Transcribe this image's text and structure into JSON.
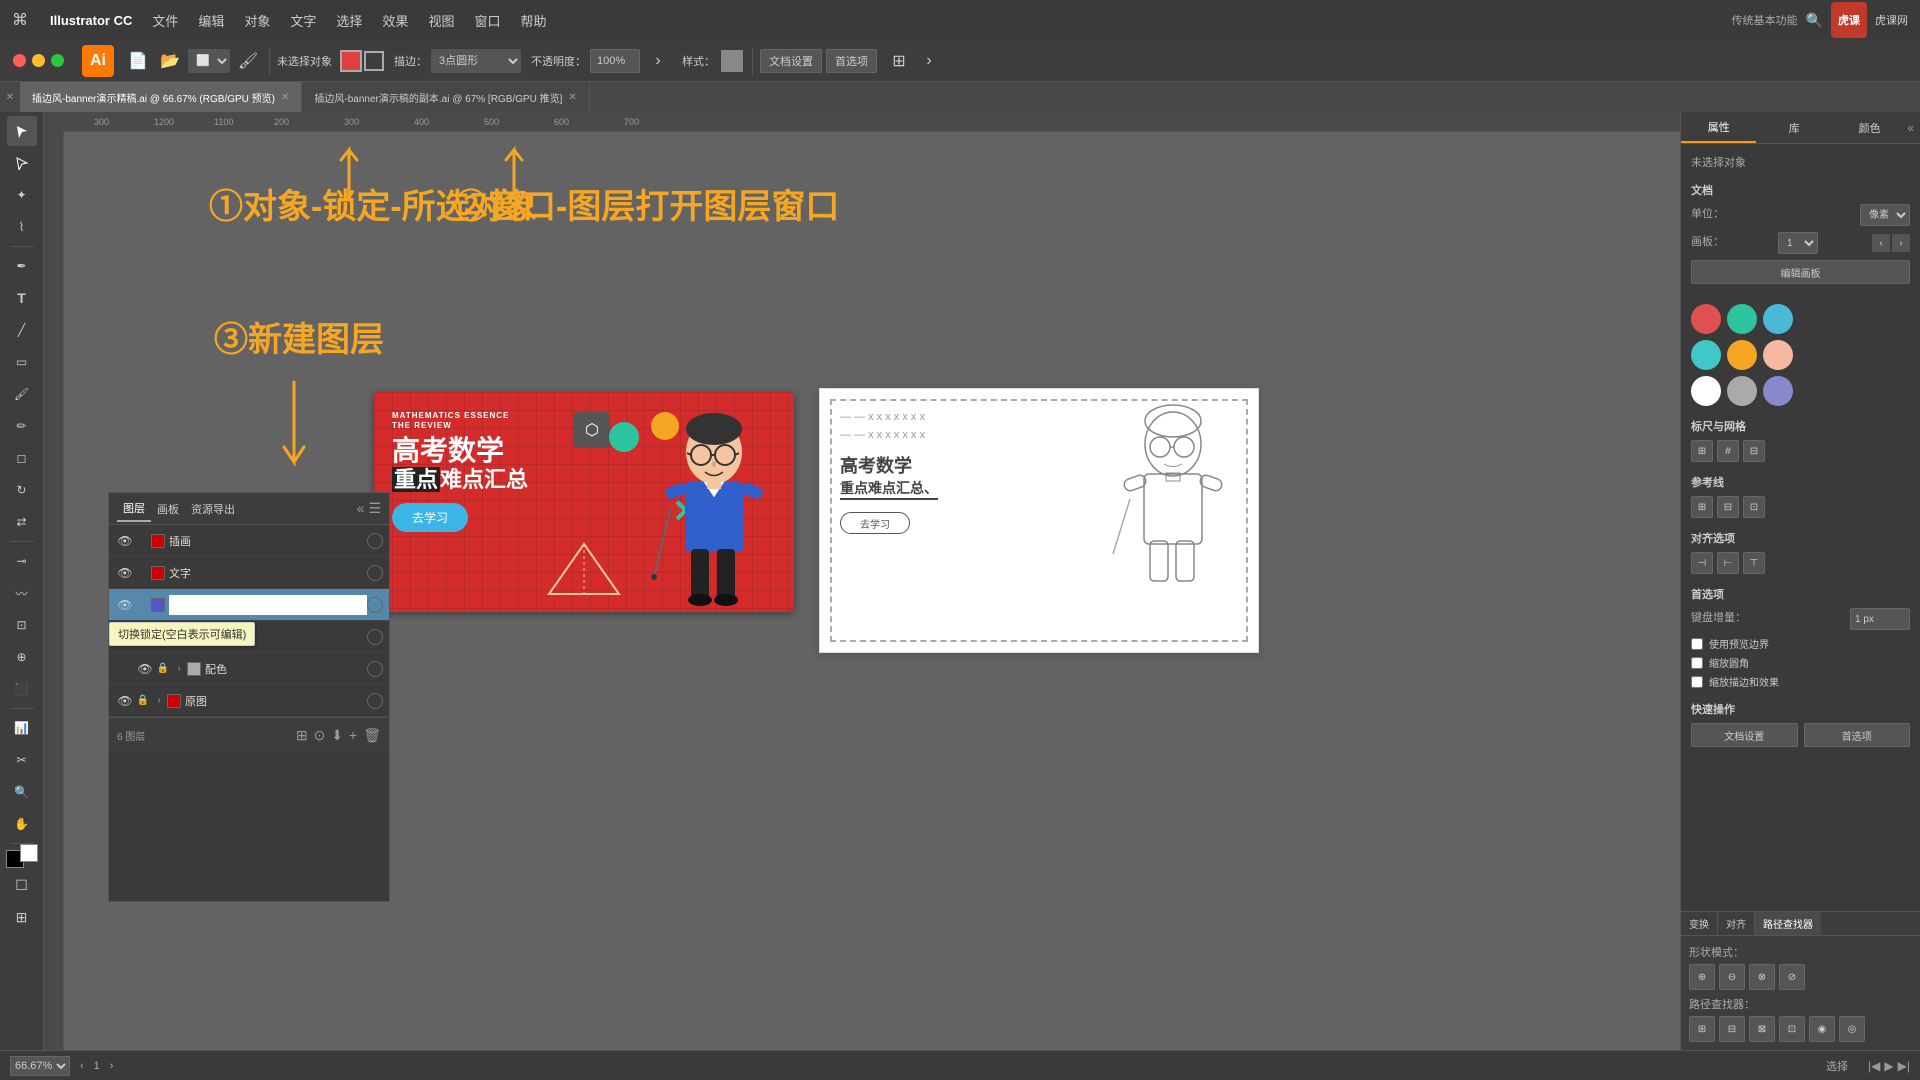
{
  "app": {
    "name": "Illustrator CC",
    "logo": "Ai",
    "title_bar_bg": "#3a3a3a"
  },
  "menu": {
    "apple": "⌘",
    "items": [
      "Illustrator CC",
      "文件",
      "编辑",
      "对象",
      "文字",
      "选择",
      "效果",
      "视图",
      "窗口",
      "帮助"
    ]
  },
  "toolbar": {
    "no_selection": "未选择对象",
    "desc_label": "描边：",
    "shape_dropdown": "3点圆形",
    "opacity_label": "不透明度：",
    "opacity_value": "100%",
    "style_label": "样式：",
    "doc_settings": "文档设置",
    "preferences": "首选项"
  },
  "tabs": [
    {
      "label": "插边风-banner演示精稿.ai @ 66.67% (RGB/GPU 预览)",
      "active": true
    },
    {
      "label": "插边风-banner演示稿的副本.ai @ 67% [RGB/GPU 推览]",
      "active": false
    }
  ],
  "canvas": {
    "zoom": "66.67%",
    "mode": "选择"
  },
  "annotations": {
    "step1": "①对象-锁定-所选对象",
    "step2": "②窗口-图层打开图层窗口",
    "step3": "③新建图层",
    "arrow1_label": "向上箭头1",
    "arrow2_label": "向上箭头2",
    "arrow3_label": "向下箭头3"
  },
  "banner": {
    "tag_line1": "MATHEMATICS ESSENCE",
    "tag_line2": "THE REVIEW",
    "title_line1": "高考数学",
    "title_line2": "重点难点汇总",
    "button_text": "去学习",
    "bg_color": "#d42b2b"
  },
  "layers_panel": {
    "tabs": [
      "图层",
      "画板",
      "资源导出"
    ],
    "layers": [
      {
        "name": "插画",
        "visible": true,
        "locked": false,
        "color": "#c00",
        "expanded": false
      },
      {
        "name": "文字",
        "visible": true,
        "locked": false,
        "color": "#c00",
        "expanded": false
      },
      {
        "name": "",
        "visible": true,
        "locked": false,
        "color": "#55c",
        "expanded": false,
        "editing": true
      },
      {
        "name": "配色",
        "visible": true,
        "locked": false,
        "color": "#aaa",
        "expanded": true,
        "sub": true
      },
      {
        "name": "配色",
        "visible": true,
        "locked": true,
        "color": "#aaa",
        "expanded": false,
        "indent": true
      },
      {
        "name": "原图",
        "visible": true,
        "locked": true,
        "color": "#c00",
        "expanded": false
      }
    ],
    "footer_text": "6 图层",
    "tooltip": "切换锁定(空白表示可编辑)"
  },
  "right_panel": {
    "tabs": [
      "属性",
      "库",
      "颜色"
    ],
    "active_tab": "属性",
    "no_selection": "未选择对象",
    "document_section": "文档",
    "unit_label": "单位：",
    "unit_value": "像素",
    "artboard_label": "画板：",
    "artboard_value": "1",
    "edit_artboard_btn": "编辑画板",
    "grid_section": "标尺与网格",
    "guides_section": "参考线",
    "align_section": "对齐选项",
    "prefs_section": "首选项",
    "kbd_increment_label": "键盘增量：",
    "kbd_increment_value": "1 px",
    "use_preview_bounds": "使用预览边界",
    "scale_corners": "缩放圆角",
    "scale_stroke_effects": "缩放描边和效果",
    "quick_actions": "快速操作",
    "doc_settings_btn": "文档设置",
    "preferences_btn": "首选项",
    "colors": [
      "#e05050",
      "#2ec4a0",
      "#4ab8d8",
      "#40c8c8",
      "#f5a623",
      "#f5b8a0",
      "#ffffff",
      "#aaaaaa",
      "#8888cc"
    ],
    "bottom_tabs": [
      "变换",
      "对齐",
      "路径查找器"
    ],
    "path_finder_label": "形状模式：",
    "path_finder_label2": "路径查找器："
  },
  "status_bar": {
    "zoom": "66.67%",
    "mode": "选择"
  }
}
